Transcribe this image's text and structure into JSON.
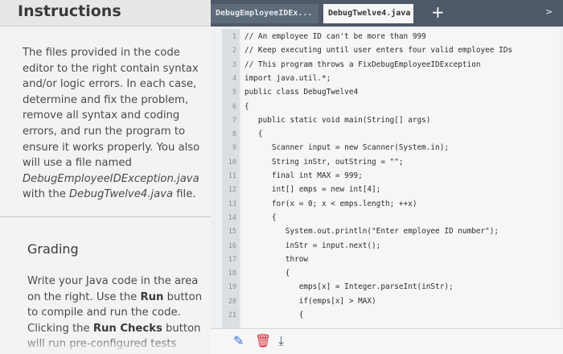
{
  "instructions": {
    "title": "Instructions",
    "p1": "The files provided in the code editor to the right contain syntax and/or logic errors. In each case, determine and fix the problem, remove all syntax and coding errors, and run the program to ensure it works properly. You also will use a file named ",
    "p1_file1": "DebugEmployeeIDException.java",
    "p1_mid": " with the ",
    "p1_file2": "DebugTwelve4.java",
    "p1_end": " file."
  },
  "grading": {
    "title": "Grading",
    "t1": "Write your Java code in the area on the right. Use the ",
    "run": "Run",
    "t2": " button to compile and run the code. Clicking the ",
    "run_checks": "Run Checks",
    "t3": " button will run pre-configured tests"
  },
  "editor": {
    "tabs": [
      {
        "label": "DebugEmployeeIDEx..."
      },
      {
        "label": "DebugTwelve4.java"
      }
    ],
    "lines": [
      {
        "n": "1",
        "text": "// An employee ID can't be more than 999"
      },
      {
        "n": "2",
        "text": "// Keep executing until user enters four valid employee IDs"
      },
      {
        "n": "3",
        "text": "// This program throws a FixDebugEmployeeIDException"
      },
      {
        "n": "4",
        "text": "import java.util.*;"
      },
      {
        "n": "5",
        "text": "public class DebugTwelve4"
      },
      {
        "n": "6",
        "text": "{"
      },
      {
        "n": "7",
        "text": "   public static void main(String[] args)"
      },
      {
        "n": "8",
        "text": "   {"
      },
      {
        "n": "9",
        "text": "      Scanner input = new Scanner(System.in);"
      },
      {
        "n": "10",
        "text": "      String inStr, outString = \"\";"
      },
      {
        "n": "11",
        "text": "      final int MAX = 999;"
      },
      {
        "n": "12",
        "text": "      int[] emps = new int[4];"
      },
      {
        "n": "13",
        "text": "      for(x = 0; x < emps.length; ++x)"
      },
      {
        "n": "14",
        "text": "      {"
      },
      {
        "n": "15",
        "text": "         System.out.println(\"Enter employee ID number\");"
      },
      {
        "n": "16",
        "text": "         inStr = input.next();"
      },
      {
        "n": "17",
        "text": "         throw"
      },
      {
        "n": "18",
        "text": "         {"
      },
      {
        "n": "19",
        "text": "            emps[x] = Integer.parseInt(inStr);"
      },
      {
        "n": "20",
        "text": "            if(emps[x] > MAX)"
      },
      {
        "n": "21",
        "text": "            {"
      }
    ]
  }
}
